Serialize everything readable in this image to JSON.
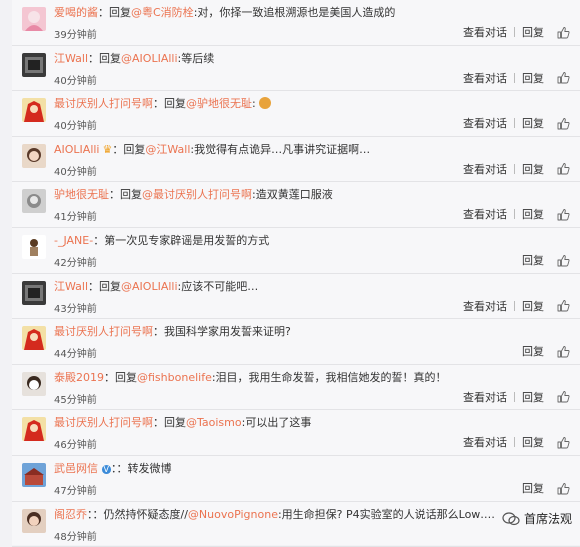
{
  "common": {
    "reply_label": "回复",
    "view_conversation": "查看对话",
    "reply_prefix": "回复",
    "colon": ":"
  },
  "comments": [
    {
      "user": "爱喝的酱",
      "prefix": "回复",
      "mention": "@粤C消防栓",
      "body": ":对，你择一致追根溯源也是美国人造成的",
      "time": "39分钟前",
      "view": true,
      "avatar": "pink"
    },
    {
      "user": "江Wall",
      "prefix": "回复",
      "mention": "@AIOLIAlli",
      "body": ":等后续",
      "time": "40分钟前",
      "view": true,
      "avatar": "dark"
    },
    {
      "user": "最讨厌别人打问号啊",
      "prefix": "回复",
      "mention": "@驴地很无耻",
      "body": ":",
      "time": "40分钟前",
      "view": true,
      "avatar": "red",
      "emoji": true
    },
    {
      "user": "AIOLIAlli",
      "prefix": "回复",
      "mention": "@江Wall",
      "body": ":我觉得有点诡异…凡事讲究证据啊…",
      "time": "40分钟前",
      "view": true,
      "avatar": "girl",
      "crown": true
    },
    {
      "user": "驴地很无耻",
      "prefix": "回复",
      "mention": "@最讨厌别人打问号啊",
      "body": ":造双黄莲口服液",
      "time": "41分钟前",
      "view": true,
      "avatar": "gray"
    },
    {
      "user": "-_JANE-",
      "prefix": "",
      "mention": "",
      "body": "第一次见专家辟谣是用发誓的方式",
      "time": "42分钟前",
      "view": false,
      "avatar": "figure"
    },
    {
      "user": "江Wall",
      "prefix": "回复",
      "mention": "@AIOLIAlli",
      "body": ":应该不可能吧…",
      "time": "43分钟前",
      "view": true,
      "avatar": "dark"
    },
    {
      "user": "最讨厌别人打问号啊",
      "prefix": "",
      "mention": "",
      "body": "我国科学家用发誓来证明?",
      "time": "44分钟前",
      "view": false,
      "avatar": "red"
    },
    {
      "user": "泰殿2019",
      "prefix": "回复",
      "mention": "@fishbonelife",
      "body": ":泪目，我用生命发誓，我相信她发的誓！真的！",
      "time": "45分钟前",
      "view": true,
      "avatar": "mask"
    },
    {
      "user": "最讨厌别人打问号啊",
      "prefix": "回复",
      "mention": "@Taoismo",
      "body": ":可以出了这事",
      "time": "46分钟前",
      "view": true,
      "avatar": "red"
    },
    {
      "user": "武邑网信",
      "prefix": "",
      "mention": "",
      "body": "：转发微博",
      "time": "47分钟前",
      "view": false,
      "avatar": "building",
      "verified": true
    },
    {
      "user": "阁忍乔",
      "prefix": "",
      "mention": "@NuovoPignone",
      "body": "：仍然持怀疑态度//",
      "body2": ":用生命担保? P4实验室的人说话那么Low……",
      "time": "48分钟前",
      "view": false,
      "avatar": "woman"
    }
  ],
  "watermark": {
    "text": "首席法观",
    "icon": "wechat-icon"
  },
  "colors": {
    "accent": "#eb7350",
    "link": "#eb7350",
    "verified": "#3b8bd9"
  }
}
